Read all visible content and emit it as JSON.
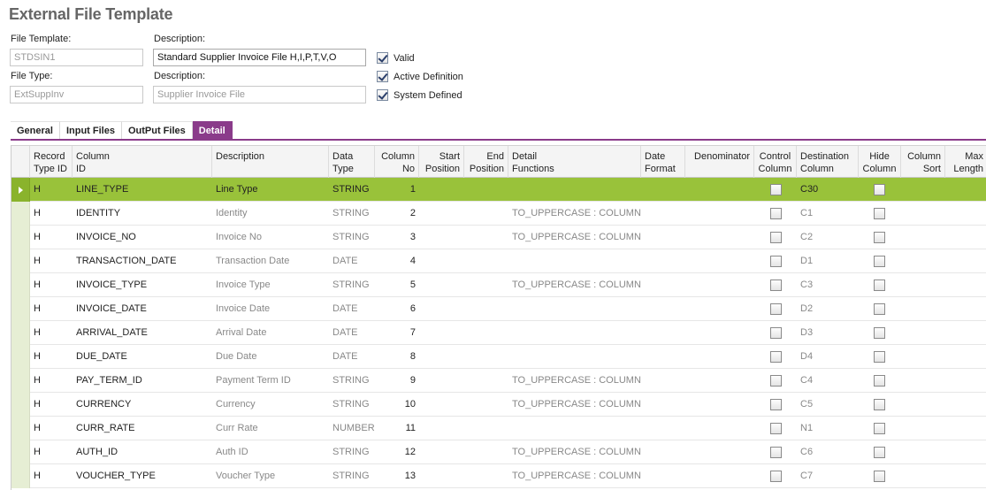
{
  "page": {
    "title": "External File Template"
  },
  "form": {
    "file_template_label": "File Template:",
    "file_template_value": "STDSIN1",
    "description1_label": "Description:",
    "description1_value": "Standard Supplier Invoice File H,I,P,T,V,O",
    "file_type_label": "File Type:",
    "file_type_value": "ExtSuppInv",
    "description2_label": "Description:",
    "description2_value": "Supplier Invoice File",
    "valid_label": "Valid",
    "active_label": "Active Definition",
    "system_label": "System Defined",
    "valid_checked": true,
    "active_checked": true,
    "system_checked": true
  },
  "tabs": [
    {
      "label": "General",
      "active": false
    },
    {
      "label": "Input Files",
      "active": false
    },
    {
      "label": "OutPut Files",
      "active": false
    },
    {
      "label": "Detail",
      "active": true
    }
  ],
  "grid": {
    "headers": {
      "record_type": "Record\nType ID",
      "column_id": "Column\nID",
      "description": "Description",
      "data_type": "Data\nType",
      "column_no": "Column\nNo",
      "start_position": "Start\nPosition",
      "end_position": "End\nPosition",
      "detail_functions": "Detail\nFunctions",
      "date_format": "Date\nFormat",
      "denominator": "Denominator",
      "control_column": "Control\nColumn",
      "destination_column": "Destination\nColumn",
      "hide_column": "Hide\nColumn",
      "column_sort": "Column\nSort",
      "max_length": "Max\nLength"
    },
    "rows": [
      {
        "record": "H",
        "column_id": "LINE_TYPE",
        "description": "Line Type",
        "data_type": "STRING",
        "column_no": "1",
        "functions": "",
        "destination": "C30",
        "selected": true
      },
      {
        "record": "H",
        "column_id": "IDENTITY",
        "description": "Identity",
        "data_type": "STRING",
        "column_no": "2",
        "functions": "TO_UPPERCASE : COLUMN...",
        "destination": "C1",
        "selected": false
      },
      {
        "record": "H",
        "column_id": "INVOICE_NO",
        "description": "Invoice No",
        "data_type": "STRING",
        "column_no": "3",
        "functions": "TO_UPPERCASE : COLUMN...",
        "destination": "C2",
        "selected": false
      },
      {
        "record": "H",
        "column_id": "TRANSACTION_DATE",
        "description": "Transaction Date",
        "data_type": "DATE",
        "column_no": "4",
        "functions": "",
        "destination": "D1",
        "selected": false
      },
      {
        "record": "H",
        "column_id": "INVOICE_TYPE",
        "description": "Invoice Type",
        "data_type": "STRING",
        "column_no": "5",
        "functions": "TO_UPPERCASE : COLUMN...",
        "destination": "C3",
        "selected": false
      },
      {
        "record": "H",
        "column_id": "INVOICE_DATE",
        "description": "Invoice Date",
        "data_type": "DATE",
        "column_no": "6",
        "functions": "",
        "destination": "D2",
        "selected": false
      },
      {
        "record": "H",
        "column_id": "ARRIVAL_DATE",
        "description": "Arrival Date",
        "data_type": "DATE",
        "column_no": "7",
        "functions": "",
        "destination": "D3",
        "selected": false
      },
      {
        "record": "H",
        "column_id": "DUE_DATE",
        "description": "Due Date",
        "data_type": "DATE",
        "column_no": "8",
        "functions": "",
        "destination": "D4",
        "selected": false
      },
      {
        "record": "H",
        "column_id": "PAY_TERM_ID",
        "description": "Payment Term ID",
        "data_type": "STRING",
        "column_no": "9",
        "functions": "TO_UPPERCASE : COLUMN...",
        "destination": "C4",
        "selected": false
      },
      {
        "record": "H",
        "column_id": "CURRENCY",
        "description": "Currency",
        "data_type": "STRING",
        "column_no": "10",
        "functions": "TO_UPPERCASE : COLUMN...",
        "destination": "C5",
        "selected": false
      },
      {
        "record": "H",
        "column_id": "CURR_RATE",
        "description": "Curr Rate",
        "data_type": "NUMBER",
        "column_no": "11",
        "functions": "",
        "destination": "N1",
        "selected": false
      },
      {
        "record": "H",
        "column_id": "AUTH_ID",
        "description": "Auth ID",
        "data_type": "STRING",
        "column_no": "12",
        "functions": "TO_UPPERCASE : COLUMN...",
        "destination": "C6",
        "selected": false
      },
      {
        "record": "H",
        "column_id": "VOUCHER_TYPE",
        "description": "Voucher Type",
        "data_type": "STRING",
        "column_no": "13",
        "functions": "TO_UPPERCASE : COLUMN...",
        "destination": "C7",
        "selected": false
      }
    ]
  }
}
